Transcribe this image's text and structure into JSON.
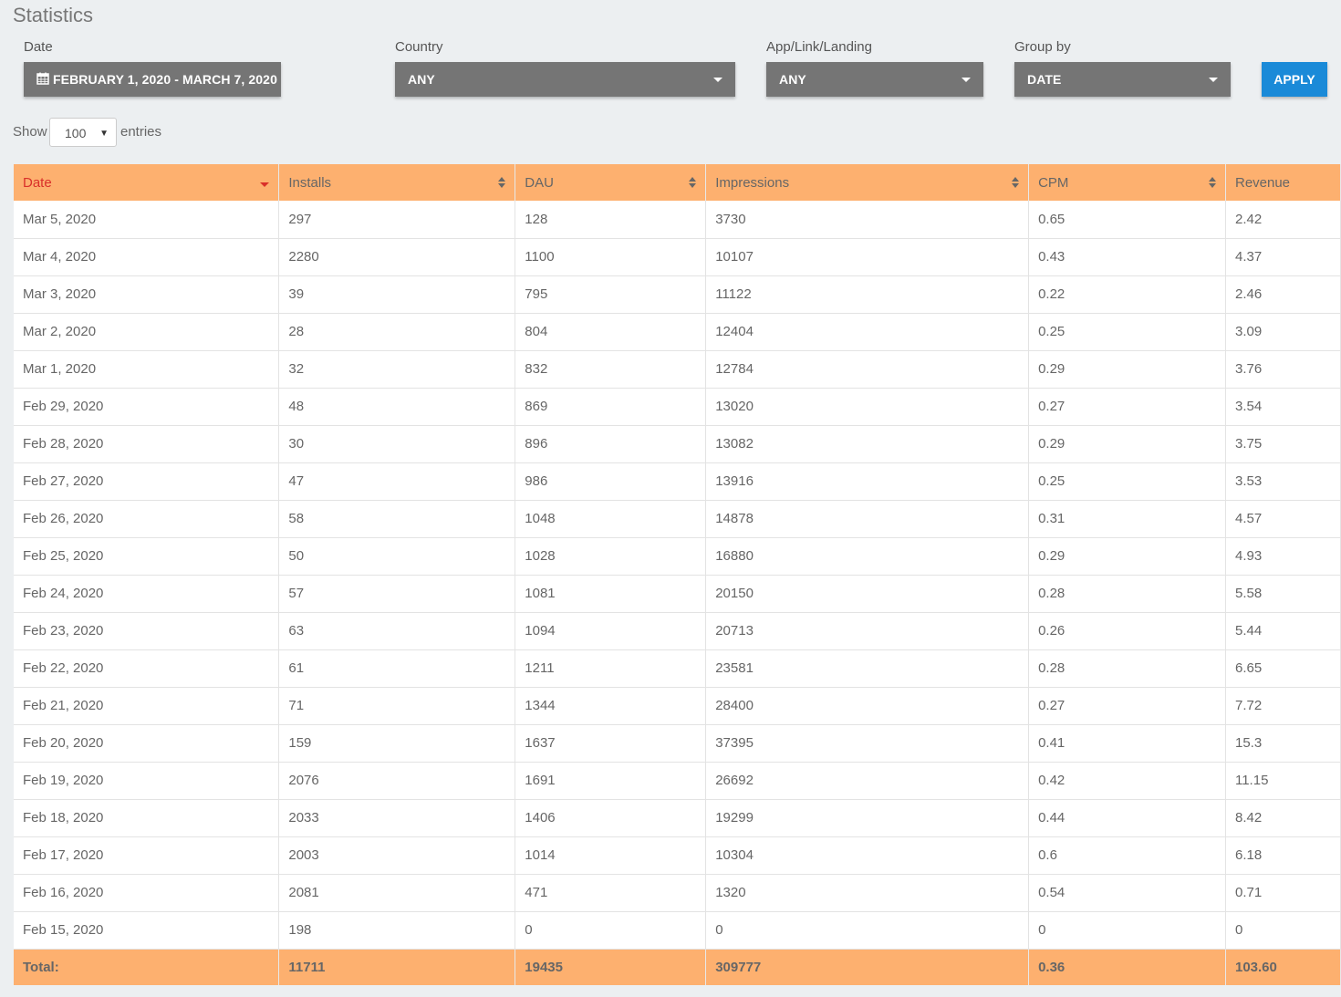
{
  "page": {
    "title": "Statistics"
  },
  "filters": {
    "date_label": "Date",
    "date_value": "FEBRUARY 1, 2020 - MARCH 7, 2020",
    "country_label": "Country",
    "country_value": "ANY",
    "app_label": "App/Link/Landing",
    "app_value": "ANY",
    "group_label": "Group by",
    "group_value": "DATE",
    "apply_label": "APPLY"
  },
  "length": {
    "show": "Show",
    "value": "100",
    "entries": "entries"
  },
  "table": {
    "headers": [
      "Date",
      "Installs",
      "DAU",
      "Impressions",
      "CPM",
      "Revenue"
    ],
    "rows": [
      [
        "Mar 5, 2020",
        "297",
        "128",
        "3730",
        "0.65",
        "2.42"
      ],
      [
        "Mar 4, 2020",
        "2280",
        "1100",
        "10107",
        "0.43",
        "4.37"
      ],
      [
        "Mar 3, 2020",
        "39",
        "795",
        "11122",
        "0.22",
        "2.46"
      ],
      [
        "Mar 2, 2020",
        "28",
        "804",
        "12404",
        "0.25",
        "3.09"
      ],
      [
        "Mar 1, 2020",
        "32",
        "832",
        "12784",
        "0.29",
        "3.76"
      ],
      [
        "Feb 29, 2020",
        "48",
        "869",
        "13020",
        "0.27",
        "3.54"
      ],
      [
        "Feb 28, 2020",
        "30",
        "896",
        "13082",
        "0.29",
        "3.75"
      ],
      [
        "Feb 27, 2020",
        "47",
        "986",
        "13916",
        "0.25",
        "3.53"
      ],
      [
        "Feb 26, 2020",
        "58",
        "1048",
        "14878",
        "0.31",
        "4.57"
      ],
      [
        "Feb 25, 2020",
        "50",
        "1028",
        "16880",
        "0.29",
        "4.93"
      ],
      [
        "Feb 24, 2020",
        "57",
        "1081",
        "20150",
        "0.28",
        "5.58"
      ],
      [
        "Feb 23, 2020",
        "63",
        "1094",
        "20713",
        "0.26",
        "5.44"
      ],
      [
        "Feb 22, 2020",
        "61",
        "1211",
        "23581",
        "0.28",
        "6.65"
      ],
      [
        "Feb 21, 2020",
        "71",
        "1344",
        "28400",
        "0.27",
        "7.72"
      ],
      [
        "Feb 20, 2020",
        "159",
        "1637",
        "37395",
        "0.41",
        "15.3"
      ],
      [
        "Feb 19, 2020",
        "2076",
        "1691",
        "26692",
        "0.42",
        "11.15"
      ],
      [
        "Feb 18, 2020",
        "2033",
        "1406",
        "19299",
        "0.44",
        "8.42"
      ],
      [
        "Feb 17, 2020",
        "2003",
        "1014",
        "10304",
        "0.6",
        "6.18"
      ],
      [
        "Feb 16, 2020",
        "2081",
        "471",
        "1320",
        "0.54",
        "0.71"
      ],
      [
        "Feb 15, 2020",
        "198",
        "0",
        "0",
        "0",
        "0"
      ]
    ],
    "total": [
      "Total:",
      "11711",
      "19435",
      "309777",
      "0.36",
      "103.60"
    ]
  }
}
